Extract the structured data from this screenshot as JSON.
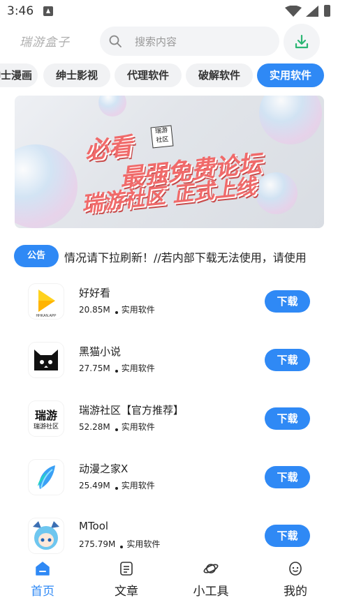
{
  "status_bar": {
    "time": "3:46"
  },
  "header": {
    "logo": "瑞游盒子",
    "search_placeholder": "搜索内容"
  },
  "categories": [
    {
      "label": "绅士漫画",
      "active": false
    },
    {
      "label": "绅士影视",
      "active": false
    },
    {
      "label": "代理软件",
      "active": false
    },
    {
      "label": "破解软件",
      "active": false
    },
    {
      "label": "实用软件",
      "active": true
    }
  ],
  "banner": {
    "line1": "必看",
    "line2": "最强免费论坛",
    "line3": "瑞游社区 正式上线",
    "stamp": "瑞游 社区"
  },
  "notice": {
    "tag": "公告",
    "text": "情况请下拉刷新！//若内部下载无法使用，请使用"
  },
  "apps": [
    {
      "name": "好好看",
      "size": "20.85M",
      "category": "实用软件",
      "button": "下载",
      "icon": "hhkan-app-icon"
    },
    {
      "name": "黑猫小说",
      "size": "27.75M",
      "category": "实用软件",
      "button": "下载",
      "icon": "black-cat-icon"
    },
    {
      "name": "瑞游社区【官方推荐】",
      "size": "52.28M",
      "category": "实用软件",
      "button": "下载",
      "icon": "ruiyou-community-icon"
    },
    {
      "name": "动漫之家X",
      "size": "25.49M",
      "category": "实用软件",
      "button": "下载",
      "icon": "feather-icon"
    },
    {
      "name": "MTool",
      "size": "275.79M",
      "category": "实用软件",
      "button": "下载",
      "icon": "anime-girl-icon"
    }
  ],
  "nav": [
    {
      "label": "首页",
      "icon": "home-icon",
      "active": true
    },
    {
      "label": "文章",
      "icon": "article-icon",
      "active": false
    },
    {
      "label": "小工具",
      "icon": "planet-icon",
      "active": false
    },
    {
      "label": "我的",
      "icon": "profile-icon",
      "active": false
    }
  ],
  "colors": {
    "accent": "#2f89f5",
    "chip_bg": "#f1f2f4",
    "search_bg": "#f3f4f6",
    "download_green": "#2bb673"
  }
}
